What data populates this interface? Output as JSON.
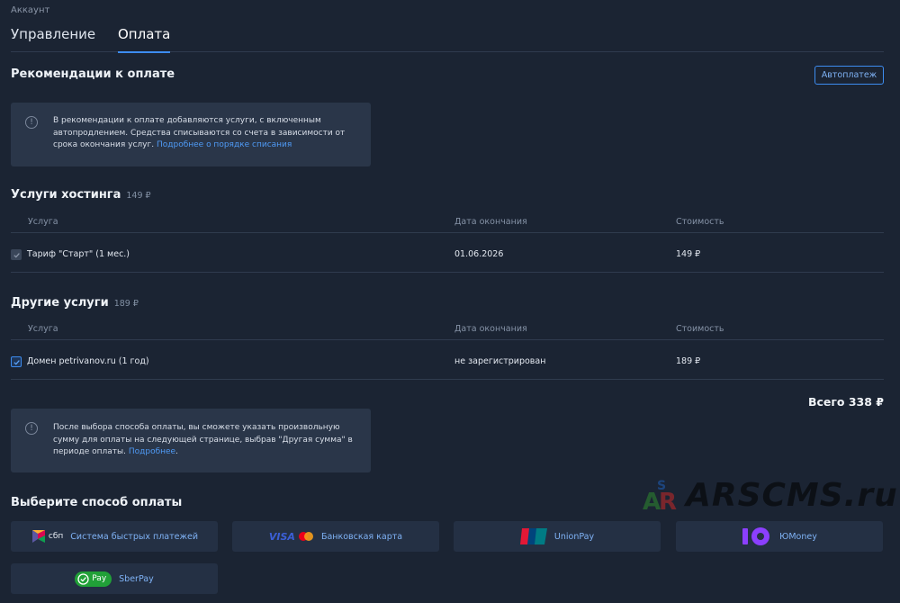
{
  "breadcrumb": "Аккаунт",
  "tabs": [
    {
      "label": "Управление",
      "active": false
    },
    {
      "label": "Оплата",
      "active": true
    }
  ],
  "recommend": {
    "title": "Рекомендации к оплате",
    "autopay_label": "Автоплатеж",
    "info_text": "В рекомендации к оплате добавляются услуги, с включенным автопродлением. Средства списываются со счета в зависимости от срока окончания услуг.",
    "info_link": "Подробнее о порядке списания"
  },
  "columns": {
    "service": "Услуга",
    "end_date": "Дата окончания",
    "cost": "Стоимость"
  },
  "hosting": {
    "title": "Услуги хостинга",
    "sum": "149 ₽",
    "rows": [
      {
        "name": "Тариф \"Старт\" (1 мес.)",
        "end_date": "01.06.2026",
        "cost": "149 ₽",
        "checked": true,
        "disabled": true
      }
    ]
  },
  "other": {
    "title": "Другие услуги",
    "sum": "189 ₽",
    "rows": [
      {
        "name": "Домен petrivanov.ru (1 год)",
        "end_date": "не зарегистрирован",
        "cost": "189 ₽",
        "checked": true,
        "disabled": false
      }
    ]
  },
  "total": "Всего 338 ₽",
  "info2": {
    "text": "После выбора способа оплаты, вы сможете указать произвольную сумму для оплаты на следующей странице, выбрав \"Другая сумма\" в периоде оплаты.",
    "link": "Подробнее"
  },
  "payment": {
    "title": "Выберите способ оплаты",
    "methods": [
      {
        "label": "Система быстрых платежей",
        "logo_text": "сбп",
        "icon": "sbp-logo-icon"
      },
      {
        "label": "Банковская карта",
        "logo_text": "VISA",
        "icon": "visa-mastercard-logo-icon"
      },
      {
        "label": "UnionPay",
        "logo_text": "UnionPay 银联",
        "icon": "unionpay-logo-icon"
      },
      {
        "label": "ЮMoney",
        "logo_text": "",
        "icon": "yoomoney-logo-icon"
      },
      {
        "label": "SberPay",
        "logo_text": "Pay",
        "icon": "sberpay-logo-icon"
      }
    ]
  },
  "watermark": "ARSCMS.ru",
  "colors": {
    "background": "#1b2433",
    "accent": "#3d8cf0",
    "info_bg": "#2a3649",
    "card_bg": "#243044",
    "link": "#4f9af5"
  }
}
